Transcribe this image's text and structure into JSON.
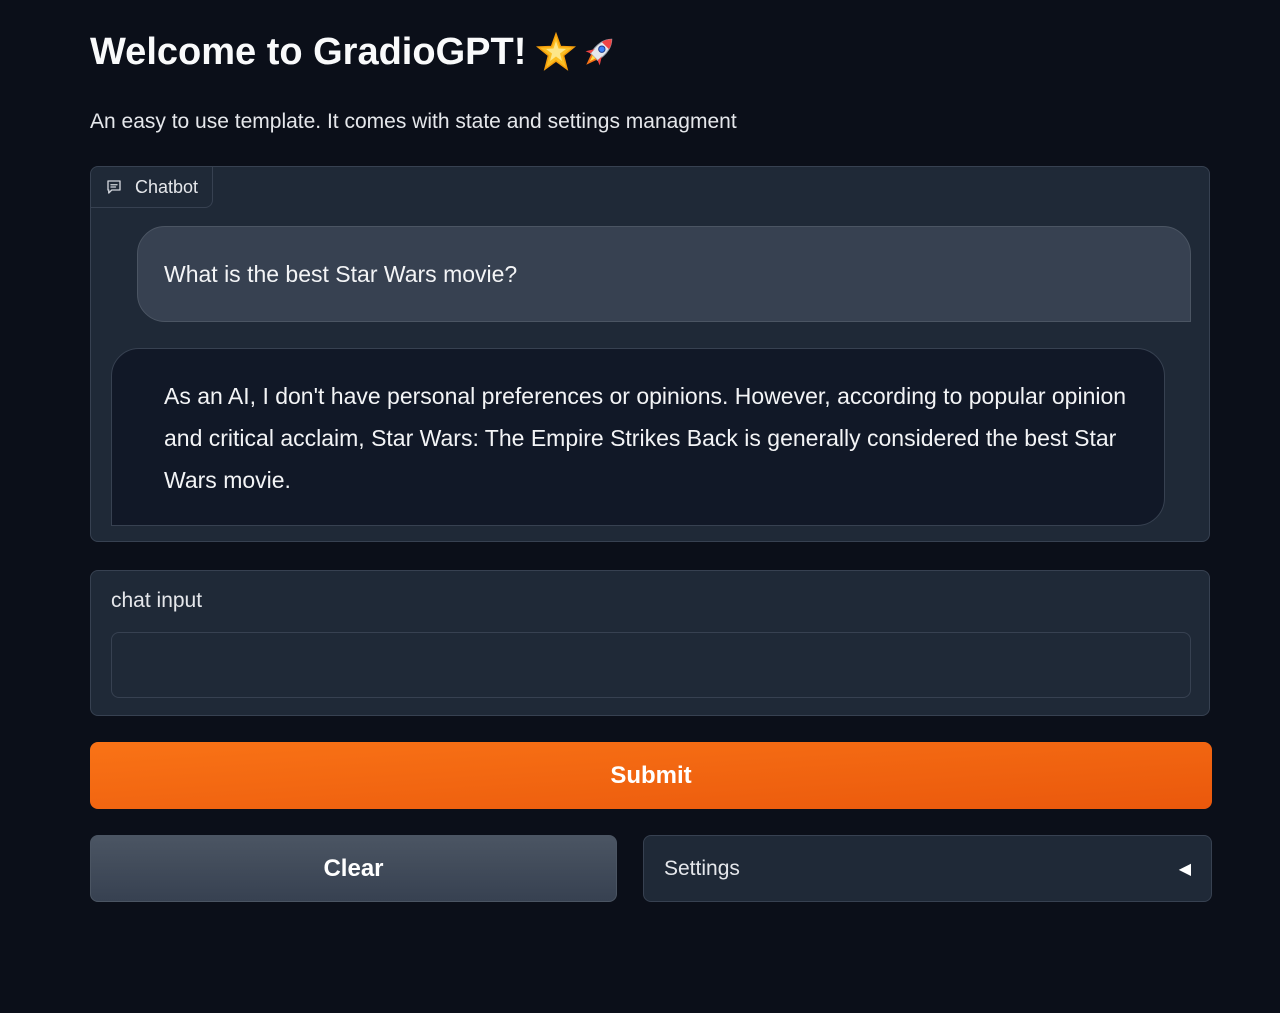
{
  "header": {
    "title": "Welcome to GradioGPT!",
    "subtitle": "An easy to use template. It comes with state and settings managment"
  },
  "chatbot": {
    "label": "Chatbot",
    "messages": [
      {
        "role": "user",
        "text": "What is the best Star Wars movie?"
      },
      {
        "role": "bot",
        "text": "As an AI, I don't have personal preferences or opinions. However, according to popular opinion and critical acclaim, Star Wars: The Empire Strikes Back is generally considered the best Star Wars movie."
      }
    ]
  },
  "input": {
    "label": "chat input",
    "value": ""
  },
  "buttons": {
    "submit": "Submit",
    "clear": "Clear"
  },
  "settings": {
    "label": "Settings",
    "arrow": "◀"
  },
  "colors": {
    "background": "#0b0f19",
    "panel": "#1f2937",
    "accent": "#f97316"
  }
}
